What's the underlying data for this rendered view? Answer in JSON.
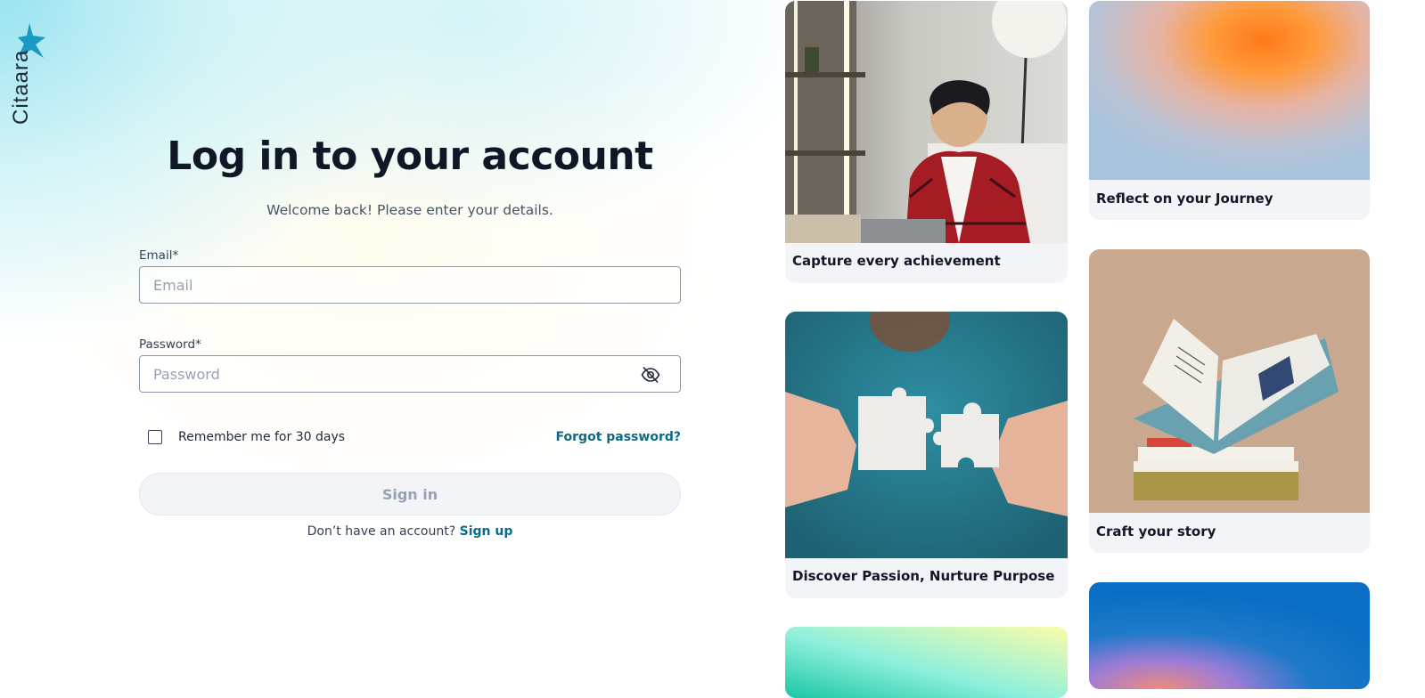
{
  "brand": {
    "name": "Citaara",
    "accent": "#1a9ac3"
  },
  "login": {
    "title": "Log in to your account",
    "subtitle": "Welcome back! Please enter your details.",
    "email_label": "Email*",
    "email_placeholder": "Email",
    "email_value": "",
    "password_label": "Password*",
    "password_placeholder": "Password",
    "password_value": "",
    "remember_label": "Remember me for 30 days",
    "remember_checked": false,
    "forgot_label": "Forgot password?",
    "signin_label": "Sign in",
    "signup_prompt": "Don’t have an account?",
    "signup_label": "Sign up",
    "link_color": "#0b6b86"
  },
  "gallery": {
    "cards": [
      {
        "caption": "Capture every achievement",
        "image": "man-with-laptop-photo"
      },
      {
        "caption": "Reflect on your Journey",
        "image": "orange-blue-gradient"
      },
      {
        "caption": "Craft your story",
        "image": "open-photo-book-photo"
      },
      {
        "caption": "Discover Passion, Nurture Purpose",
        "image": "puzzle-pieces-photo"
      },
      {
        "caption": "",
        "image": "teal-yellow-gradient"
      },
      {
        "caption": "",
        "image": "blue-gradient"
      }
    ]
  }
}
